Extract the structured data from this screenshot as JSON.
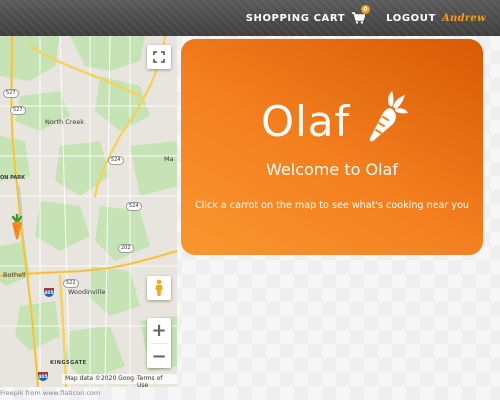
{
  "header": {
    "cart_label": "SHOPPING CART",
    "cart_count": "0",
    "logout_label": "LOGOUT",
    "username": "Andrew"
  },
  "map": {
    "labels": {
      "north_creek": "North Creek",
      "ma": "Ma",
      "bothell": "Bothell",
      "woodinville": "Woodinville",
      "kingsgate": "KINGSGATE",
      "on_park": "ON PARK"
    },
    "shields": {
      "r527a": "527",
      "r527b": "527",
      "r524": "524",
      "r524b": "524",
      "r522": "522",
      "r202": "202",
      "r405a": "405",
      "r405b": "405"
    },
    "controls": {
      "zoom_in": "+",
      "zoom_out": "−"
    },
    "attribution": {
      "map_data": "Map data ©2020 Google",
      "terms": "Terms of Use"
    }
  },
  "credit": "Freepik from www.flaticon.com",
  "card": {
    "logo_text": "Olaf",
    "title": "Welcome to Olaf",
    "subtitle": "Click a carrot on the map to see what's cooking near you"
  },
  "colors": {
    "accent": "#f2a01a",
    "card_start": "#f9962e",
    "card_end": "#d85a05",
    "header": "#4a4a4a"
  }
}
